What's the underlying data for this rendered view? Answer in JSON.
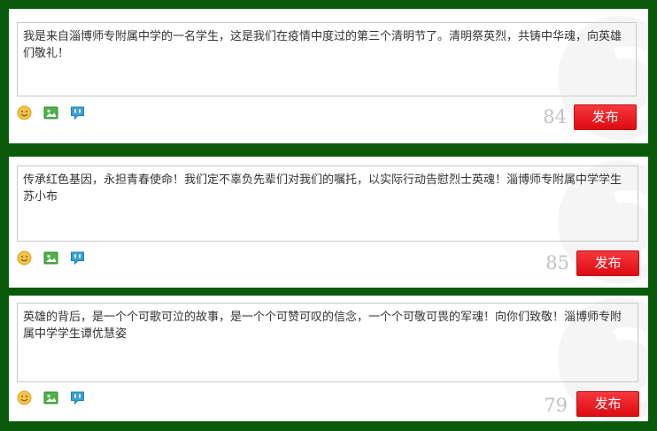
{
  "colors": {
    "frame_bg": "#0b5a0b",
    "panel_bg": "#ffffff",
    "publish_button": "#e8141a",
    "counter_text": "#c2c2c2"
  },
  "icons": [
    "emoji-icon",
    "image-icon",
    "topic-icon"
  ],
  "posts": [
    {
      "text": "我是来自淄博师专附属中学的一名学生，这是我们在疫情中度过的第三个清明节了。清明祭英烈，共铸中华魂，向英雄们敬礼！",
      "counter": "84",
      "publish_label": "发布"
    },
    {
      "text": "传承红色基因，永担青春使命！我们定不辜负先辈们对我们的嘱托，以实际行动告慰烈士英魂！淄博师专附属中学学生苏小布",
      "counter": "85",
      "publish_label": "发布"
    },
    {
      "text": "英雄的背后，是一个个可歌可泣的故事，是一个个可赞可叹的信念，一个个可敬可畏的军魂！向你们致敬！淄博师专附属中学学生谭优慧姿",
      "counter": "79",
      "publish_label": "发布"
    }
  ]
}
